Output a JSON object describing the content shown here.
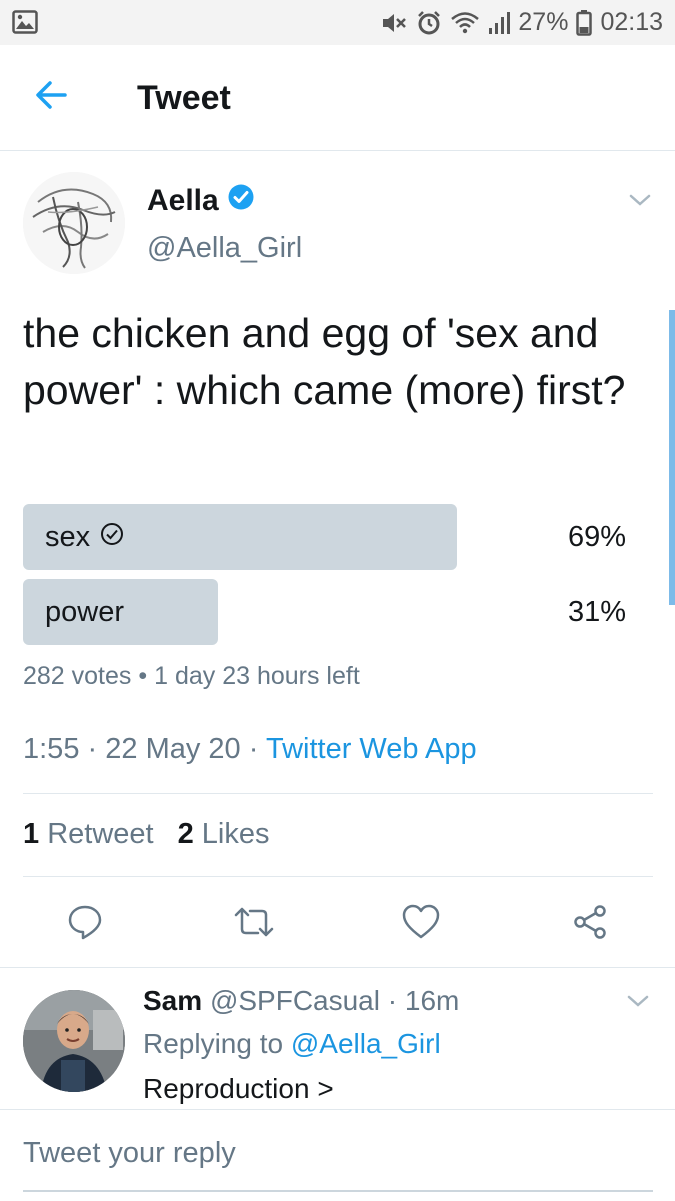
{
  "status_bar": {
    "battery": "27%",
    "time": "02:13",
    "icons": [
      "gallery-icon",
      "mute-icon",
      "alarm-icon",
      "wifi-icon",
      "signal-icon",
      "battery-icon"
    ]
  },
  "app_bar": {
    "title": "Tweet",
    "back_icon": "arrow-left-icon"
  },
  "tweet": {
    "author_name": "Aella",
    "verified": true,
    "handle": "@Aella_Girl",
    "text": "the chicken and egg of 'sex and power' : which came (more) first?",
    "poll": {
      "options": [
        {
          "label": "sex",
          "percent_text": "69%",
          "percent": 69,
          "selected": true
        },
        {
          "label": "power",
          "percent_text": "31%",
          "percent": 31,
          "selected": false
        }
      ],
      "votes": "282 votes",
      "separator": "•",
      "time_left": "1 day 23 hours left"
    },
    "time": "1:55",
    "date": "22 May 20",
    "dot": "·",
    "source": "Twitter Web App",
    "retweets_count": "1",
    "retweets_label": "Retweet",
    "likes_count": "2",
    "likes_label": "Likes"
  },
  "actions": [
    "reply-icon",
    "retweet-icon",
    "like-icon",
    "share-icon"
  ],
  "reply": {
    "name": "Sam",
    "handle": "@SPFCasual",
    "dot": "·",
    "time": "16m",
    "replying_prefix": "Replying to",
    "replying_handle": "@Aella_Girl",
    "text": "Reproduction >"
  },
  "compose": {
    "placeholder": "Tweet your reply"
  },
  "colors": {
    "accent": "#1b95e0",
    "poll_fill": "#ccd6dd",
    "secondary_text": "#657786",
    "verified": "#1da1f2"
  }
}
